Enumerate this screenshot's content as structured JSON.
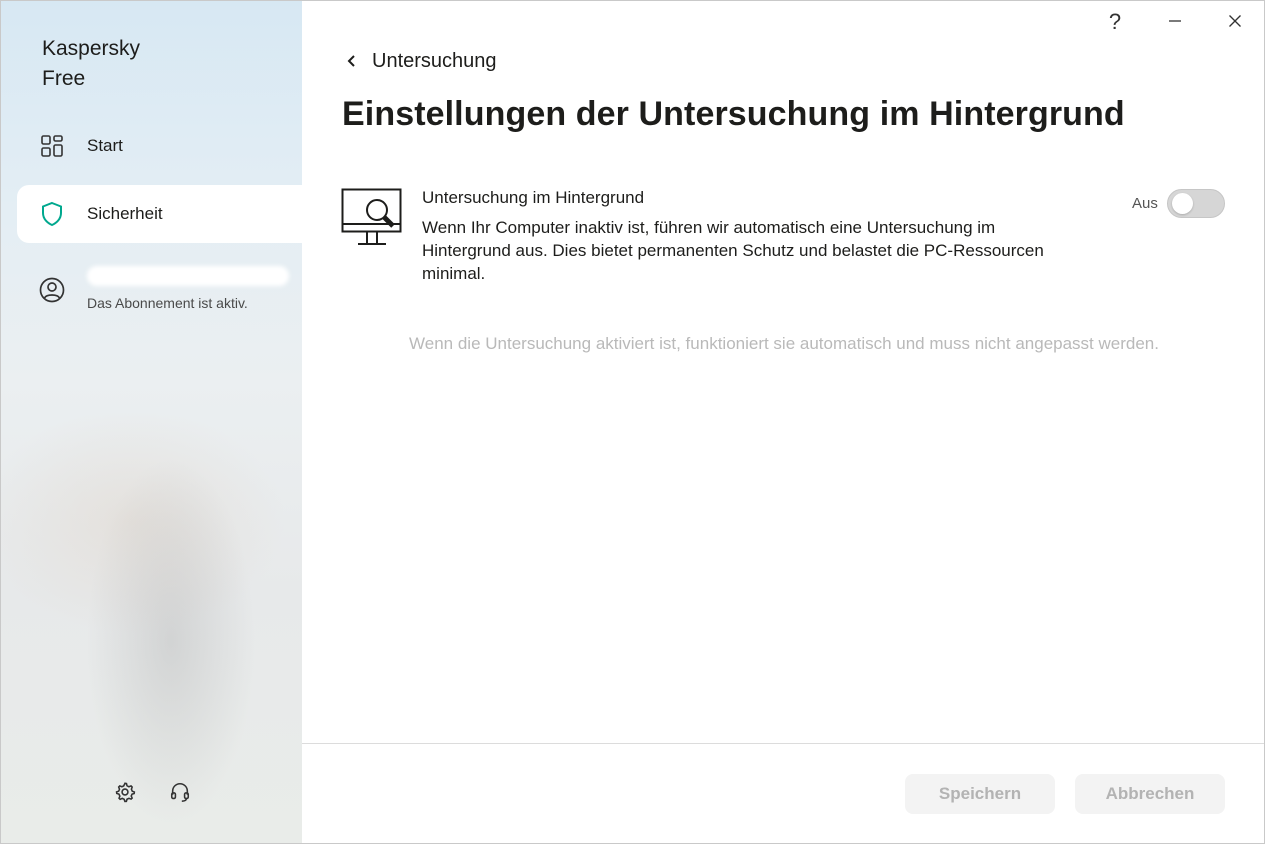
{
  "app": {
    "title_line1": "Kaspersky",
    "title_line2": "Free"
  },
  "sidebar": {
    "items": [
      {
        "label": "Start",
        "icon": "dashboard-icon"
      },
      {
        "label": "Sicherheit",
        "icon": "shield-icon",
        "active": true
      }
    ],
    "account": {
      "status": "Das Abonnement ist aktiv.",
      "icon": "user-circle-icon"
    },
    "bottom_icons": [
      "gear-icon",
      "headset-icon"
    ]
  },
  "window_controls": {
    "help": "?",
    "minimize": "minimize-icon",
    "close": "close-icon"
  },
  "main": {
    "back_label": "Untersuchung",
    "page_title": "Einstellungen der Untersuchung im Hintergrund",
    "feature": {
      "title": "Untersuchung im Hintergrund",
      "description": "Wenn Ihr Computer inaktiv ist, führen wir automatisch eine Untersuchung im Hintergrund aus. Dies bietet permanenten Schutz und belastet die PC-Ressourcen minimal.",
      "toggle_label": "Aus",
      "enabled": false,
      "icon": "monitor-search-icon"
    },
    "hint": "Wenn die Untersuchung aktiviert ist, funktioniert sie automatisch und muss nicht angepasst werden."
  },
  "footer": {
    "save_label": "Speichern",
    "cancel_label": "Abbrechen"
  },
  "colors": {
    "accent": "#00a88e",
    "toggle_off": "#d6d6d6",
    "disabled_text": "#b3b3b3"
  }
}
